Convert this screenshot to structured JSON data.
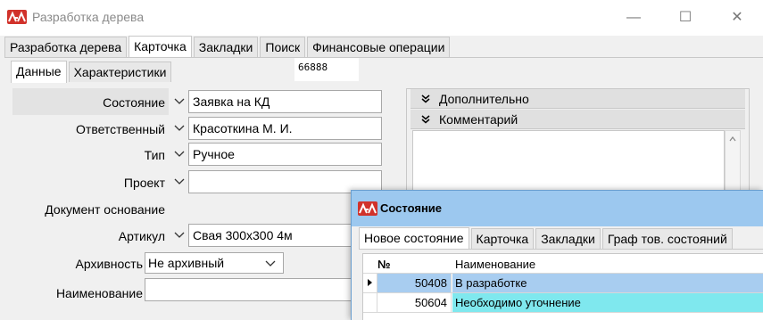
{
  "window": {
    "title": "Разработка дерева",
    "minimize": "—",
    "maximize": "☐",
    "close": "✕"
  },
  "main_tabs": [
    {
      "label": "Разработка дерева",
      "active": false
    },
    {
      "label": "Карточка",
      "active": true
    },
    {
      "label": "Закладки",
      "active": false
    },
    {
      "label": "Поиск",
      "active": false
    },
    {
      "label": "Финансовые операции",
      "active": false
    }
  ],
  "sub_tabs": [
    {
      "label": "Данные",
      "active": true
    },
    {
      "label": "Характеристики",
      "active": false
    }
  ],
  "code": "66888",
  "form": {
    "status_label": "Состояние",
    "status_value": "Заявка на КД",
    "responsible_label": "Ответственный",
    "responsible_value": "Красоткина М. И.",
    "type_label": "Тип",
    "type_value": "Ручное",
    "project_label": "Проект",
    "project_value": "",
    "base_doc_label": "Документ основание",
    "article_label": "Артикул",
    "article_value": "Свая 300х300 4м",
    "archive_label": "Архивность",
    "archive_value": "Не архивный",
    "name_label": "Наименование",
    "name_value": ""
  },
  "right_panel": {
    "additional_label": "Дополнительно",
    "comment_label": "Комментарий"
  },
  "dialog": {
    "title": "Состояние",
    "tabs": [
      {
        "label": "Новое состояние",
        "active": true
      },
      {
        "label": "Карточка",
        "active": false
      },
      {
        "label": "Закладки",
        "active": false
      },
      {
        "label": "Граф тов. состояний",
        "active": false
      }
    ],
    "grid": {
      "col_num": "№",
      "col_name": "Наименование",
      "rows": [
        {
          "num": "50408",
          "name": "В разработке",
          "color": "#a8cdf0"
        },
        {
          "num": "50604",
          "name": "Необходимо уточнение",
          "color": "#7fe8ee"
        }
      ]
    }
  },
  "colors": {
    "logo": "#d1322b",
    "dialog_title_bg": "#9cc8ef"
  }
}
